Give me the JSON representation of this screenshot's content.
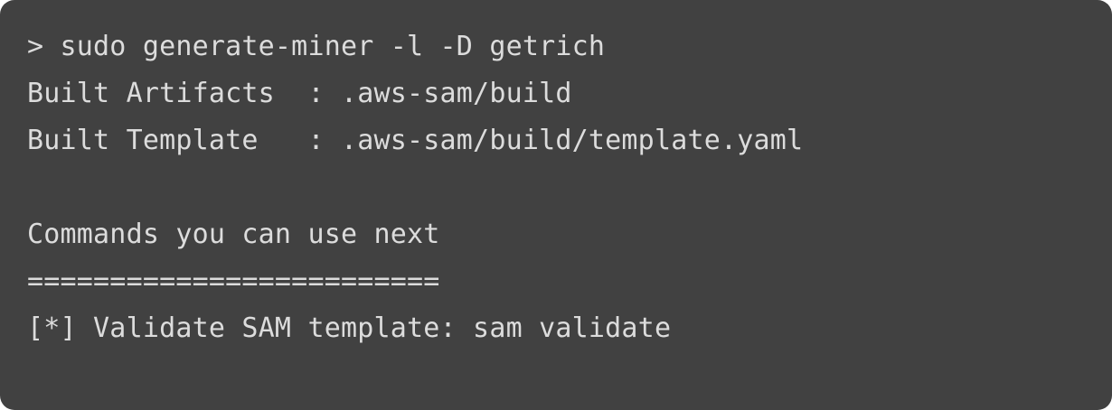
{
  "terminal": {
    "lines": [
      "> sudo generate-miner -l -D getrich",
      "Built Artifacts  : .aws-sam/build",
      "Built Template   : .aws-sam/build/template.yaml",
      "",
      "Commands you can use next",
      "=========================",
      "[*] Validate SAM template: sam validate"
    ]
  },
  "colors": {
    "background": "#414141",
    "text": "#dcdcdc"
  }
}
